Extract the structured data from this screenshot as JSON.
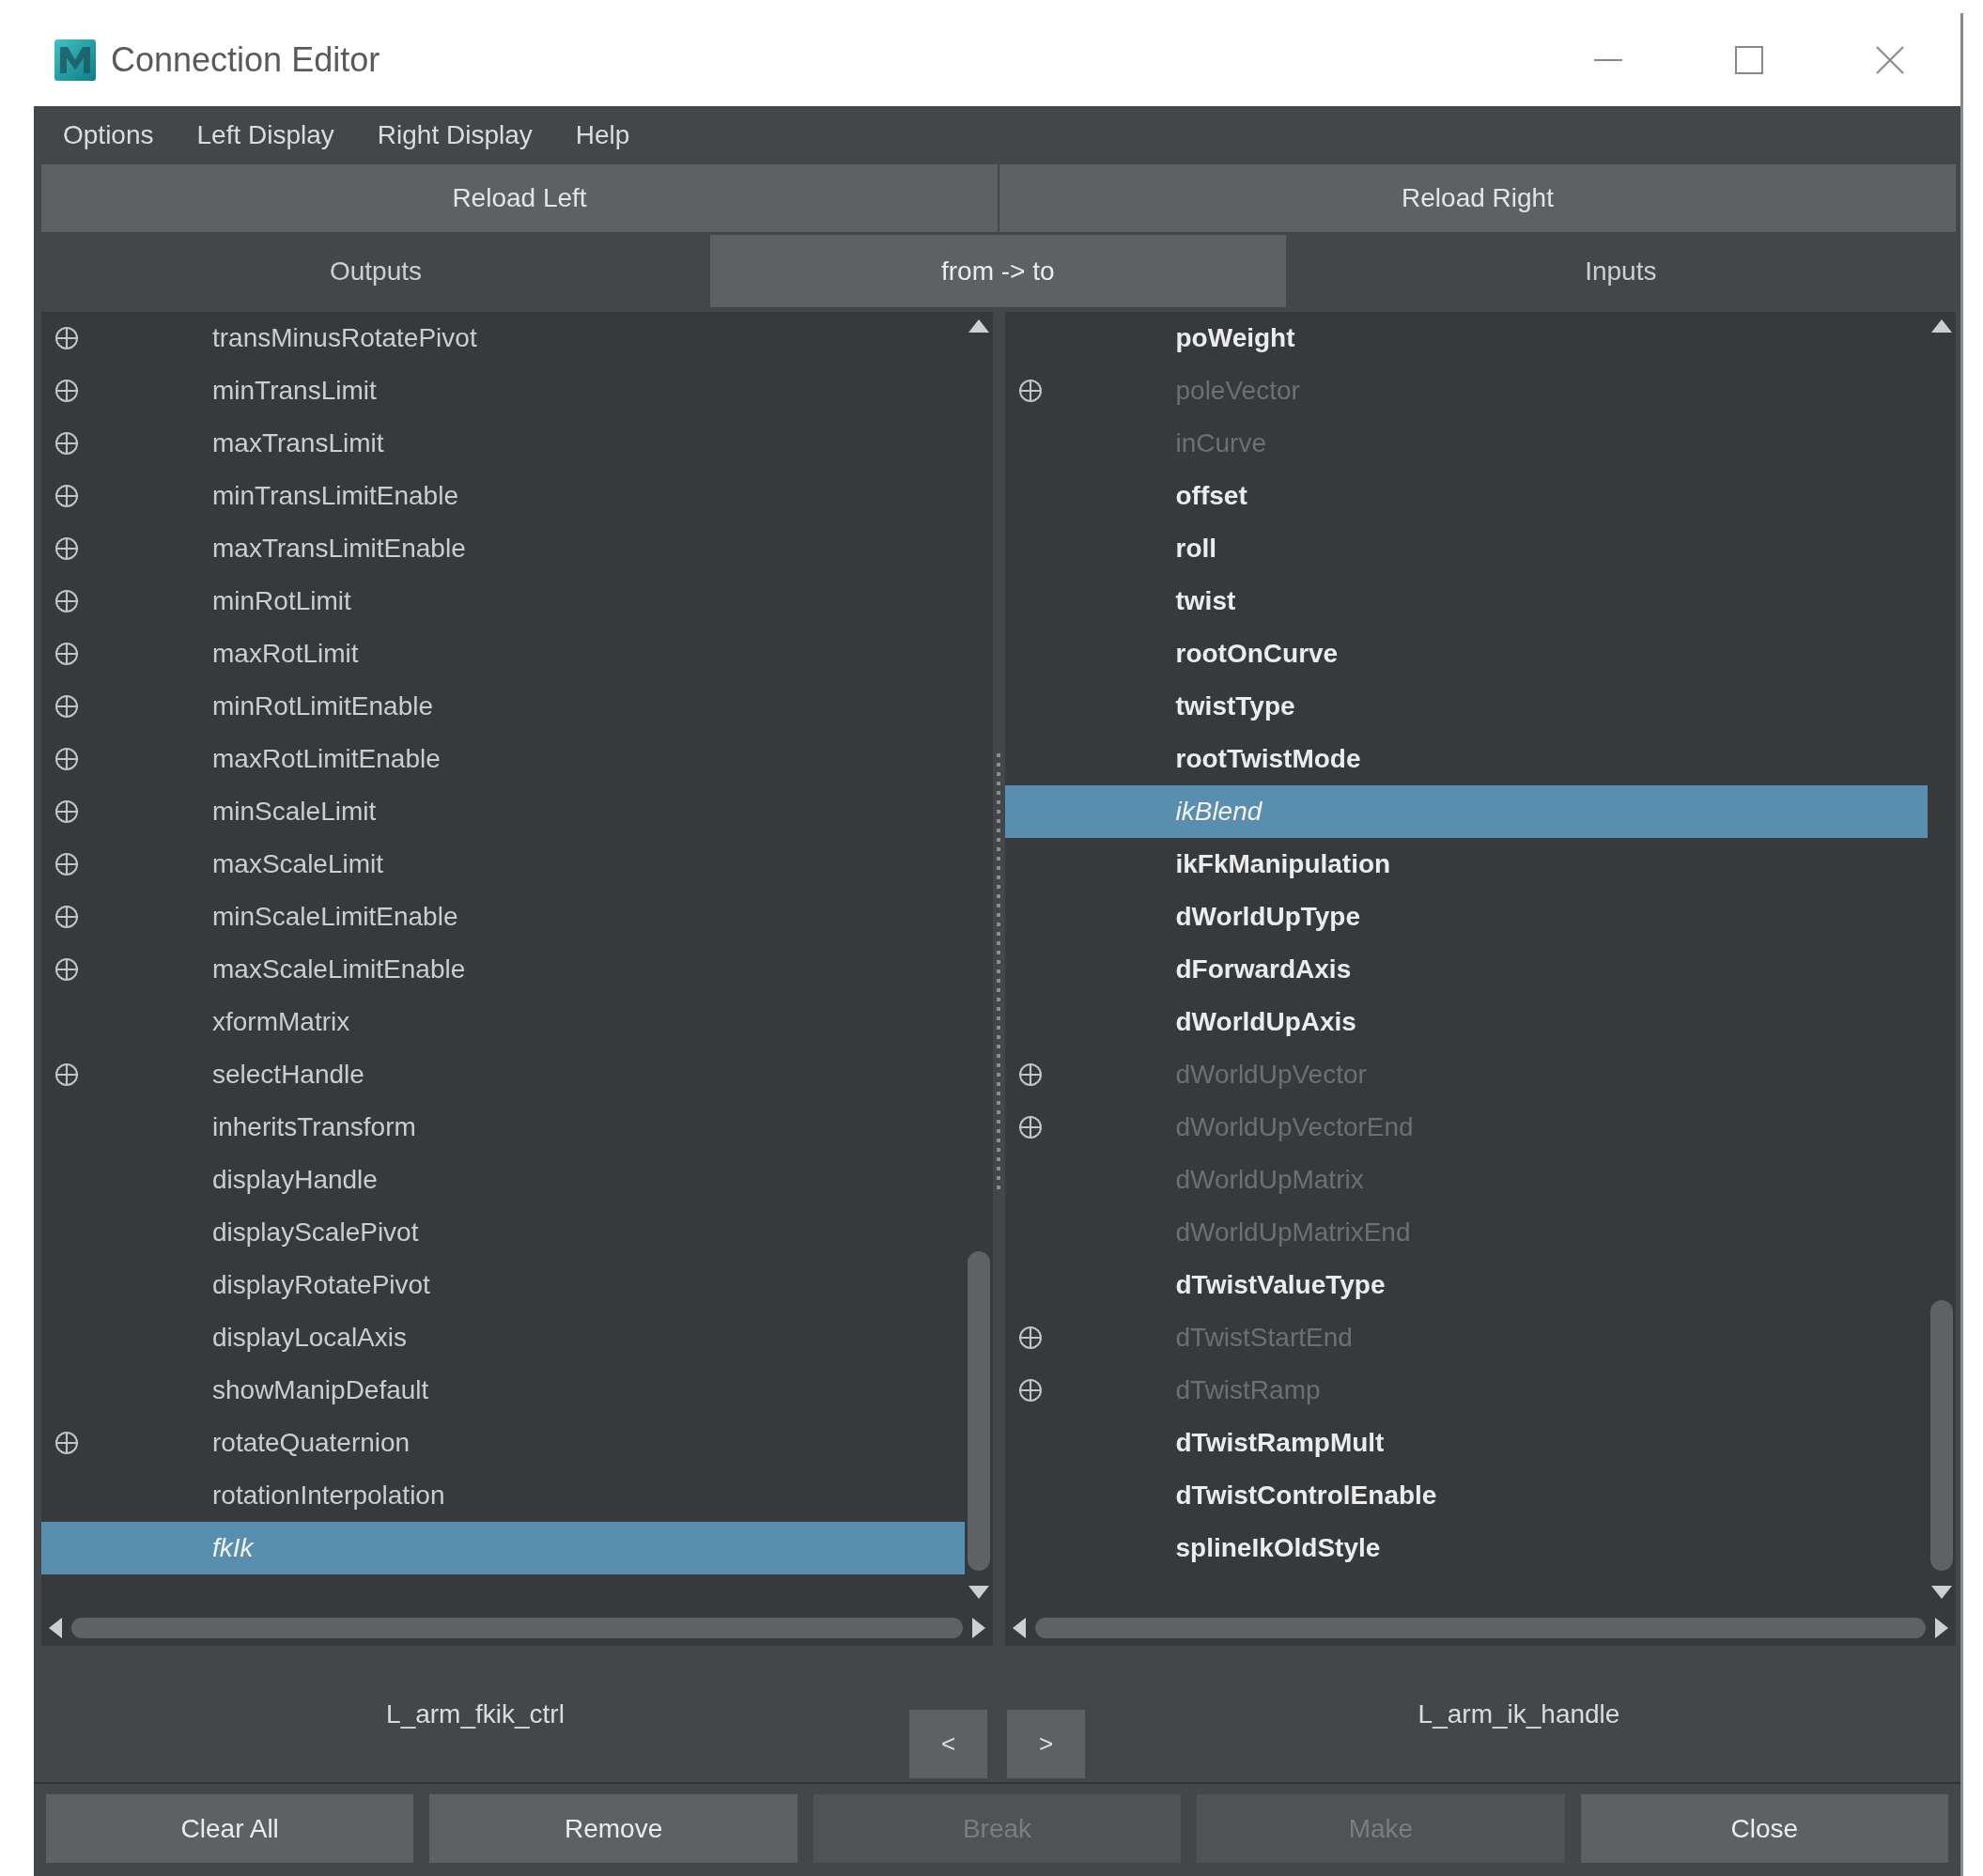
{
  "window": {
    "title": "Connection Editor"
  },
  "menu": [
    "Options",
    "Left Display",
    "Right Display",
    "Help"
  ],
  "reload_buttons": [
    "Reload Left",
    "Reload Right"
  ],
  "tabs": [
    {
      "label": "Outputs",
      "selected": false
    },
    {
      "label": "from -> to",
      "selected": true
    },
    {
      "label": "Inputs",
      "selected": false
    }
  ],
  "left_list": {
    "rows": [
      {
        "label": "transMinusRotatePivot",
        "expandable": true,
        "kind": "plain",
        "selected": false
      },
      {
        "label": "minTransLimit",
        "expandable": true,
        "kind": "plain",
        "selected": false
      },
      {
        "label": "maxTransLimit",
        "expandable": true,
        "kind": "plain",
        "selected": false
      },
      {
        "label": "minTransLimitEnable",
        "expandable": true,
        "kind": "plain",
        "selected": false
      },
      {
        "label": "maxTransLimitEnable",
        "expandable": true,
        "kind": "plain",
        "selected": false
      },
      {
        "label": "minRotLimit",
        "expandable": true,
        "kind": "plain",
        "selected": false
      },
      {
        "label": "maxRotLimit",
        "expandable": true,
        "kind": "plain",
        "selected": false
      },
      {
        "label": "minRotLimitEnable",
        "expandable": true,
        "kind": "plain",
        "selected": false
      },
      {
        "label": "maxRotLimitEnable",
        "expandable": true,
        "kind": "plain",
        "selected": false
      },
      {
        "label": "minScaleLimit",
        "expandable": true,
        "kind": "plain",
        "selected": false
      },
      {
        "label": "maxScaleLimit",
        "expandable": true,
        "kind": "plain",
        "selected": false
      },
      {
        "label": "minScaleLimitEnable",
        "expandable": true,
        "kind": "plain",
        "selected": false
      },
      {
        "label": "maxScaleLimitEnable",
        "expandable": true,
        "kind": "plain",
        "selected": false
      },
      {
        "label": "xformMatrix",
        "expandable": false,
        "kind": "plain",
        "selected": false
      },
      {
        "label": "selectHandle",
        "expandable": true,
        "kind": "plain",
        "selected": false
      },
      {
        "label": "inheritsTransform",
        "expandable": false,
        "kind": "plain",
        "selected": false
      },
      {
        "label": "displayHandle",
        "expandable": false,
        "kind": "plain",
        "selected": false
      },
      {
        "label": "displayScalePivot",
        "expandable": false,
        "kind": "plain",
        "selected": false
      },
      {
        "label": "displayRotatePivot",
        "expandable": false,
        "kind": "plain",
        "selected": false
      },
      {
        "label": "displayLocalAxis",
        "expandable": false,
        "kind": "plain",
        "selected": false
      },
      {
        "label": "showManipDefault",
        "expandable": false,
        "kind": "plain",
        "selected": false
      },
      {
        "label": "rotateQuaternion",
        "expandable": true,
        "kind": "plain",
        "selected": false
      },
      {
        "label": "rotationInterpolation",
        "expandable": false,
        "kind": "plain",
        "selected": false
      },
      {
        "label": "fkIk",
        "expandable": false,
        "kind": "plain",
        "selected": true
      }
    ]
  },
  "right_list": {
    "rows": [
      {
        "label": "poWeight",
        "expandable": false,
        "kind": "bold",
        "selected": false
      },
      {
        "label": "poleVector",
        "expandable": true,
        "kind": "dim",
        "selected": false
      },
      {
        "label": "inCurve",
        "expandable": false,
        "kind": "dim",
        "selected": false
      },
      {
        "label": "offset",
        "expandable": false,
        "kind": "bold",
        "selected": false
      },
      {
        "label": "roll",
        "expandable": false,
        "kind": "bold",
        "selected": false
      },
      {
        "label": "twist",
        "expandable": false,
        "kind": "bold",
        "selected": false
      },
      {
        "label": "rootOnCurve",
        "expandable": false,
        "kind": "bold",
        "selected": false
      },
      {
        "label": "twistType",
        "expandable": false,
        "kind": "bold",
        "selected": false
      },
      {
        "label": "rootTwistMode",
        "expandable": false,
        "kind": "bold",
        "selected": false
      },
      {
        "label": "ikBlend",
        "expandable": false,
        "kind": "plain",
        "selected": true
      },
      {
        "label": "ikFkManipulation",
        "expandable": false,
        "kind": "bold",
        "selected": false
      },
      {
        "label": "dWorldUpType",
        "expandable": false,
        "kind": "bold",
        "selected": false
      },
      {
        "label": "dForwardAxis",
        "expandable": false,
        "kind": "bold",
        "selected": false
      },
      {
        "label": "dWorldUpAxis",
        "expandable": false,
        "kind": "bold",
        "selected": false
      },
      {
        "label": "dWorldUpVector",
        "expandable": true,
        "kind": "dim",
        "selected": false
      },
      {
        "label": "dWorldUpVectorEnd",
        "expandable": true,
        "kind": "dim",
        "selected": false
      },
      {
        "label": "dWorldUpMatrix",
        "expandable": false,
        "kind": "dim",
        "selected": false
      },
      {
        "label": "dWorldUpMatrixEnd",
        "expandable": false,
        "kind": "dim",
        "selected": false
      },
      {
        "label": "dTwistValueType",
        "expandable": false,
        "kind": "bold",
        "selected": false
      },
      {
        "label": "dTwistStartEnd",
        "expandable": true,
        "kind": "dim",
        "selected": false
      },
      {
        "label": "dTwistRamp",
        "expandable": true,
        "kind": "dim",
        "selected": false
      },
      {
        "label": "dTwistRampMult",
        "expandable": false,
        "kind": "bold",
        "selected": false
      },
      {
        "label": "dTwistControlEnable",
        "expandable": false,
        "kind": "bold",
        "selected": false
      },
      {
        "label": "splineIkOldStyle",
        "expandable": false,
        "kind": "bold",
        "selected": false
      }
    ]
  },
  "left_node": "L_arm_fkik_ctrl",
  "right_node": "L_arm_ik_handle",
  "arrow_buttons": [
    "<",
    ">"
  ],
  "buttons": [
    {
      "label": "Clear All",
      "disabled": false
    },
    {
      "label": "Remove",
      "disabled": false
    },
    {
      "label": "Break",
      "disabled": true
    },
    {
      "label": "Make",
      "disabled": true
    },
    {
      "label": "Close",
      "disabled": false
    }
  ]
}
